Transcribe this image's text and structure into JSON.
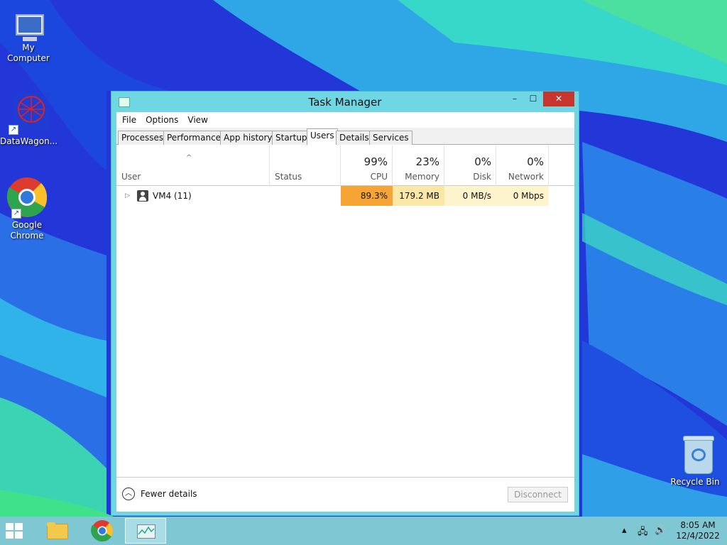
{
  "desktop": {
    "icons": [
      {
        "label": "My Computer"
      },
      {
        "label": "DataWagon..."
      },
      {
        "label": "Google Chrome"
      },
      {
        "label": "Recycle Bin"
      }
    ]
  },
  "window": {
    "title": "Task Manager",
    "controls": {
      "minimize": "–",
      "maximize": "☐",
      "close": "✕"
    },
    "menu": [
      "File",
      "Options",
      "View"
    ],
    "tabs": [
      "Processes",
      "Performance",
      "App history",
      "Startup",
      "Users",
      "Details",
      "Services"
    ],
    "active_tab": "Users",
    "columns": {
      "user": {
        "label": "User"
      },
      "status": {
        "label": "Status"
      },
      "cpu": {
        "pct": "99%",
        "label": "CPU"
      },
      "memory": {
        "pct": "23%",
        "label": "Memory"
      },
      "disk": {
        "pct": "0%",
        "label": "Disk"
      },
      "network": {
        "pct": "0%",
        "label": "Network"
      }
    },
    "rows": [
      {
        "user": "VM4 (11)",
        "status": "",
        "cpu": "89.3%",
        "memory": "179.2 MB",
        "disk": "0 MB/s",
        "network": "0 Mbps"
      }
    ],
    "footer": {
      "fewer_details": "Fewer details",
      "disconnect": "Disconnect"
    }
  },
  "taskbar": {
    "time": "8:05 AM",
    "date": "12/4/2022"
  },
  "colors": {
    "cpu_heat": "#f7a436",
    "memory_heat": "#fbe7a6",
    "low_heat": "#fdf3cc",
    "window_frame": "#6fd6e4",
    "close_button": "#c7352c"
  }
}
